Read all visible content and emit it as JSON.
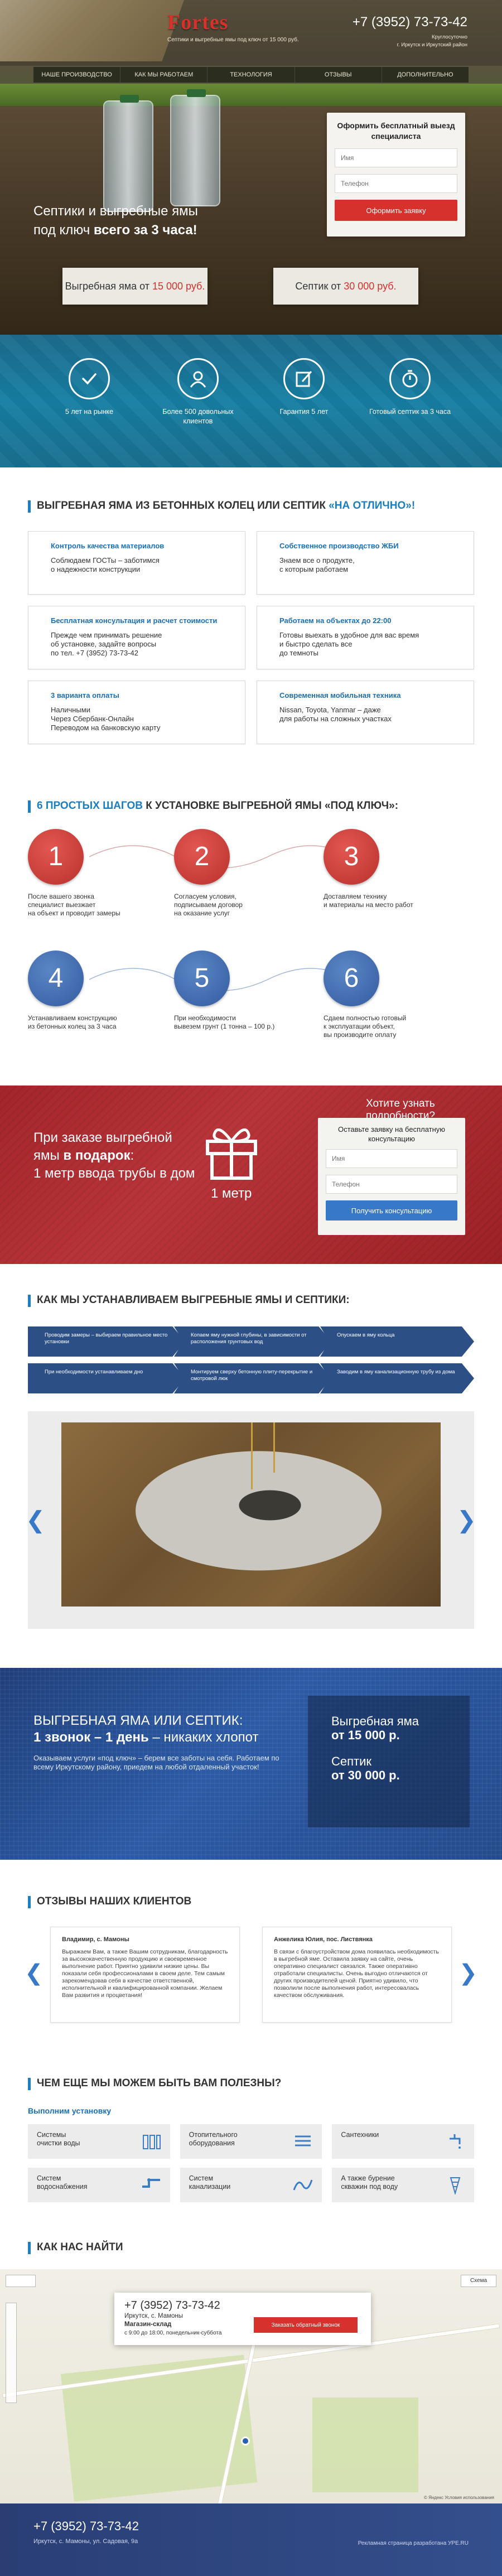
{
  "header": {
    "logo": "Fortes",
    "tagline": "Септики и выгребные ямы под ключ от 15 000 руб.",
    "phone": "+7 (3952) 73-73-42",
    "phone_note_1": "Круглосуточно",
    "phone_note_2": "г. Иркутск и Иркутский район"
  },
  "nav": [
    "НАШЕ ПРОИЗВОДСТВО",
    "КАК МЫ РАБОТАЕМ",
    "ТЕХНОЛОГИЯ",
    "ОТЗЫВЫ",
    "ДОПОЛНИТЕЛЬНО"
  ],
  "hero": {
    "title_line1": "Септики и выгребные ямы",
    "title_line2_plain": "под ключ ",
    "title_line2_bold": "всего за 3 часа!",
    "form_title": "Оформить бесплатный выезд специалиста",
    "name_placeholder": "Имя",
    "phone_placeholder": "Телефон",
    "submit": "Оформить заявку",
    "price1_label": "Выгребная яма от ",
    "price1_value": "15 000 руб.",
    "price2_label": "Септик от ",
    "price2_value": "30 000 руб."
  },
  "stats": [
    {
      "icon": "check-icon",
      "text": "5 лет на рынке"
    },
    {
      "icon": "client-icon",
      "text": "Более 500 довольных клиентов"
    },
    {
      "icon": "guarantee-icon",
      "text": "Гарантия 5 лет"
    },
    {
      "icon": "timer-icon",
      "text": "Готовый септик за 3 часа"
    }
  ],
  "features": {
    "title_plain": "ВЫГРЕБНАЯ ЯМА ИЗ БЕТОННЫХ КОЛЕЦ ИЛИ СЕПТИК ",
    "title_blue": "«НА ОТЛИЧНО»!",
    "cards": [
      {
        "title": "Контроль качества материалов",
        "text": "Соблюдаем ГОСТы – заботимся\nо надежности конструкции"
      },
      {
        "title": "Собственное производство ЖБИ",
        "text": "Знаем все о продукте,\nс которым работаем"
      },
      {
        "title": "Бесплатная консультация и расчет стоимости",
        "text": "Прежде чем принимать решение\nоб установке, задайте вопросы\nпо тел. +7 (3952) 73-73-42"
      },
      {
        "title": "Работаем на объектах до 22:00",
        "text": "Готовы выехать в удобное для вас время\nи быстро сделать все\nдо темноты"
      },
      {
        "title": "3 варианта оплаты",
        "text": "Наличными\nЧерез Сбербанк-Онлайн\nПереводом на банковскую карту"
      },
      {
        "title": "Современная мобильная техника",
        "text": "Nissan, Toyota, Yanmar – даже\nдля работы на сложных участках"
      }
    ]
  },
  "steps": {
    "title_blue": "6 ПРОСТЫХ ШАГОВ",
    "title_plain": " К УСТАНОВКЕ ВЫГРЕБНОЙ ЯМЫ «ПОД КЛЮЧ»:",
    "items": [
      {
        "num": "1",
        "text": "После вашего звонка\nспециалист выезжает\nна объект и проводит замеры"
      },
      {
        "num": "2",
        "text": "Согласуем условия,\nподписываем договор\nна оказание услуг"
      },
      {
        "num": "3",
        "text": "Доставляем технику\nи материалы на место работ"
      },
      {
        "num": "4",
        "text": "Устанавливаем конструкцию\nиз бетонных колец за 3 часа"
      },
      {
        "num": "5",
        "text": "При необходимости\nвывезем грунт (1 тонна – 100 р.)"
      },
      {
        "num": "6",
        "text": "Сдаем полностью готовый\nк эксплуатации объект,\nвы производите оплату"
      }
    ]
  },
  "gift": {
    "line1": "При заказе выгребной",
    "line2_plain": "ямы ",
    "line2_bold": "в подарок",
    "line2_end": ":",
    "line3": "1 метр ввода трубы в дом",
    "icon_label": "1 метр",
    "question": "Хотите узнать подробности?",
    "form_title": "Оставьте заявку на бесплатную консультацию",
    "name_placeholder": "Имя",
    "phone_placeholder": "Телефон",
    "submit": "Получить консультацию"
  },
  "how": {
    "title": "КАК МЫ УСТАНАВЛИВАЕМ ВЫГРЕБНЫЕ ЯМЫ И СЕПТИКИ:",
    "stages": [
      "Проводим замеры – выбираем правильное место установки",
      "Копаем яму нужной глубины, в зависимости от расположения грунтовых вод",
      "Опускаем в яму кольца",
      "При необходимости устанавливаем дно",
      "Монтируем сверху бетонную плиту-перекрытие и смотровой люк",
      "Заводим в яму канализационную трубу из дома"
    ]
  },
  "call": {
    "title_line1": "ВЫГРЕБНАЯ ЯМА ИЛИ СЕПТИК:",
    "title_bold": "1 звонок – 1 день",
    "title_end": " – никаких хлопот",
    "text": "Оказываем услуги «под ключ» – берем все заботы на себя. Работаем по всему Иркутскому району, приедем на любой отдаленный участок!",
    "price1_label": "Выгребная яма",
    "price1_value": "от 15 000 р.",
    "price2_label": "Септик",
    "price2_value": "от 30 000 р."
  },
  "reviews": {
    "title": "ОТЗЫВЫ НАШИХ КЛИЕНТОВ",
    "items": [
      {
        "author": "Владимир, с. Мамоны",
        "text": "Выражаем Вам, а также Вашим сотрудникам, благодарность за высококачественную продукцию и своевременное выполнение работ. Приятно удивили низкие цены. Вы показали себя профессионалами в своем деле. Тем самым зарекомендовав себя в качестве ответственной, исполнительной и квалифицированной компании. Желаем Вам развития и процветания!"
      },
      {
        "author": "Анжелика Юлия, пос. Листвянка",
        "text": "В связи с благоустройством дома появилась необходимость в выгребной яме. Оставила заявку на сайте, очень оперативно специалист связался. Также оперативно отработали специалисты. Очень выгодно отличаются от других производителей ценой. Приятно удивило, что позволили после выполнения работ, интересовалась качеством обслуживания."
      }
    ]
  },
  "services": {
    "title": "ЧЕМ ЕЩЕ МЫ МОЖЕМ БЫТЬ ВАМ ПОЛЕЗНЫ?",
    "subtitle": "Выполним установку",
    "items": [
      {
        "text": "Системы\nочистки воды",
        "icon": "filter-icon"
      },
      {
        "text": "Отопительного\nоборудования",
        "icon": "radiator-icon"
      },
      {
        "text": "Сантехники",
        "icon": "faucet-icon"
      },
      {
        "text": "Систем\nводоснабжения",
        "icon": "pipe-icon"
      },
      {
        "text": "Систем\nканализации",
        "icon": "sewer-icon"
      },
      {
        "text": "А также бурение\nскважин под воду",
        "icon": "drill-icon"
      }
    ]
  },
  "map": {
    "title": "КАК НАС НАЙТИ",
    "phone": "+7 (3952) 73-73-42",
    "address": "Иркутск, с. Мамоны",
    "place": "Магазин-склад",
    "hours": "с 9:00 до 18:00, понедельник-суббота",
    "callback": "Заказать обратный звонок",
    "map_type": "Схема",
    "copyright": "© Яндекс  Условия использования"
  },
  "footer": {
    "phone": "+7 (3952) 73-73-42",
    "address": "Иркутск, с. Мамоны, ул. Садовая, 9а",
    "credit": "Рекламная страница разработана УРЕ.RU"
  }
}
